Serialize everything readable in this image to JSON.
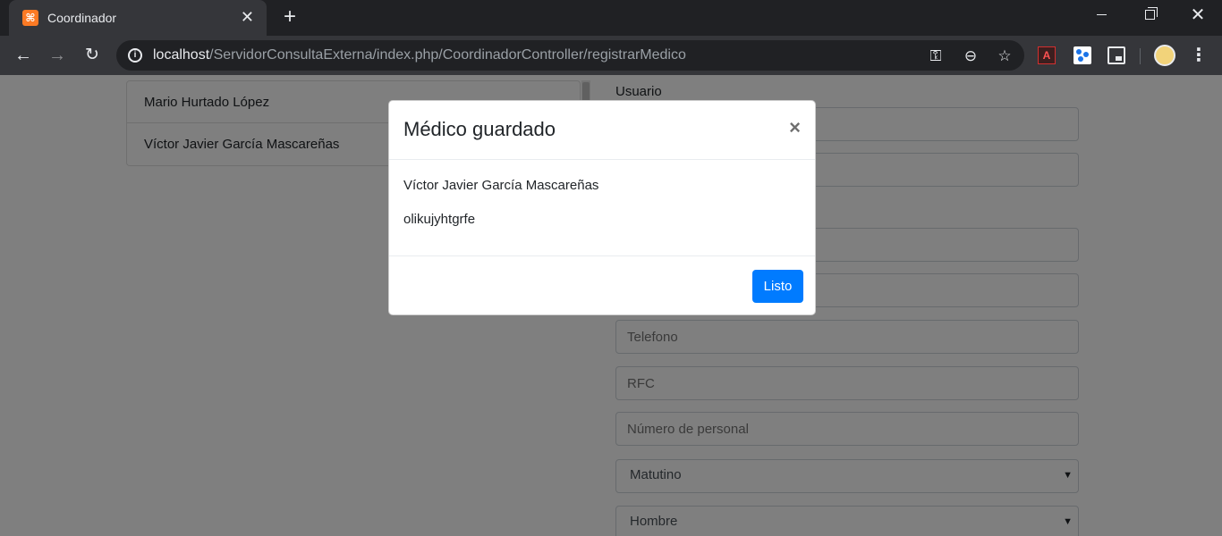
{
  "browser": {
    "tab": {
      "title": "Coordinador",
      "favicon_glyph": "⌘",
      "close_glyph": "✕"
    },
    "new_tab_glyph": "+",
    "window_buttons": {
      "close_glyph": "✕"
    },
    "nav": {
      "back_glyph": "←",
      "forward_glyph": "→",
      "reload_glyph": "↻"
    },
    "url": {
      "host": "localhost",
      "path": "/ServidorConsultaExterna/index.php/CoordinadorController/registrarMedico"
    },
    "omnibox_icons": [
      "key-icon",
      "zoom-out-icon",
      "star-icon"
    ],
    "icon_glyphs": {
      "info": "i",
      "key": "⚿",
      "zoom": "⊖",
      "star": "☆",
      "pdf": "A",
      "menu": "⋮"
    }
  },
  "page": {
    "medicos": [
      {
        "name": "Mario Hurtado López"
      },
      {
        "name": "Víctor Javier García Mascareñas"
      }
    ],
    "form": {
      "usuario_label": "Usuario",
      "telefono_placeholder": "Telefono",
      "rfc_placeholder": "RFC",
      "numero_personal_placeholder": "Número de personal",
      "turno_selected": "Matutino",
      "sexo_selected": "Hombre",
      "caret_glyph": "▼"
    }
  },
  "modal": {
    "title": "Médico guardado",
    "close_glyph": "×",
    "line1": "Víctor Javier García Mascareñas",
    "line2": "olikujyhtgrfe",
    "confirm_label": "Listo"
  },
  "colors": {
    "primary": "#007bff",
    "chrome_dark": "#202124",
    "chrome_toolbar": "#35363a"
  }
}
